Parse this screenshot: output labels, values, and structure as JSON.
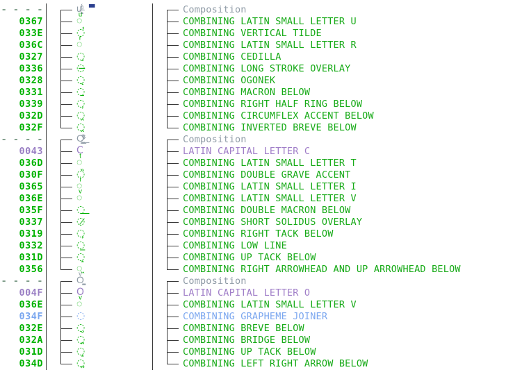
{
  "app": {
    "title": "Unicode Composition Tree",
    "composition_label": "Composition",
    "group_separator": "- - - -"
  },
  "colors": {
    "combining_green": "#00b200",
    "base_letter_purple": "#9a7fc4",
    "format_char_blue": "#7ba7ef",
    "heading_gray": "#8f9ba6",
    "separator_dash": "#7f9d8a",
    "tree_line": "#3a3a3a",
    "background": "#ffffff"
  },
  "groups": [
    {
      "header": {
        "code": "- - - -",
        "glyph": "u̶̧̨̱̹̭̯ͧ̾ͬ",
        "name": "Composition",
        "color": "gray",
        "code_color": "dash"
      },
      "rows": [
        {
          "code": "0367",
          "glyph": "◌ͧ",
          "name": "COMBINING LATIN SMALL LETTER U",
          "color": "green"
        },
        {
          "code": "033E",
          "glyph": "◌̾",
          "name": "COMBINING VERTICAL TILDE",
          "color": "green"
        },
        {
          "code": "036C",
          "glyph": "◌ͬ",
          "name": "COMBINING LATIN SMALL LETTER R",
          "color": "green"
        },
        {
          "code": "0327",
          "glyph": "◌̧",
          "name": "COMBINING CEDILLA",
          "color": "green"
        },
        {
          "code": "0336",
          "glyph": "◌̶",
          "name": "COMBINING LONG STROKE OVERLAY",
          "color": "green"
        },
        {
          "code": "0328",
          "glyph": "◌̨",
          "name": "COMBINING OGONEK",
          "color": "green"
        },
        {
          "code": "0331",
          "glyph": "◌̱",
          "name": "COMBINING MACRON BELOW",
          "color": "green"
        },
        {
          "code": "0339",
          "glyph": "◌̹",
          "name": "COMBINING RIGHT HALF RING BELOW",
          "color": "green"
        },
        {
          "code": "032D",
          "glyph": "◌̭",
          "name": "COMBINING CIRCUMFLEX ACCENT BELOW",
          "color": "green"
        },
        {
          "code": "032F",
          "glyph": "◌̯",
          "name": "COMBINING INVERTED BREVE BELOW",
          "color": "green"
        }
      ]
    },
    {
      "header": {
        "code": "- - - -",
        "glyph": "C̷̙̲̝͖ͭ̏ͥͮ͟",
        "name": "Composition",
        "color": "gray",
        "code_color": "dash"
      },
      "rows": [
        {
          "code": "0043",
          "glyph": "C",
          "name": "LATIN CAPITAL LETTER C",
          "color": "purple"
        },
        {
          "code": "036D",
          "glyph": "◌ͭ",
          "name": "COMBINING LATIN SMALL LETTER T",
          "color": "green"
        },
        {
          "code": "030F",
          "glyph": "◌̏",
          "name": "COMBINING DOUBLE GRAVE ACCENT",
          "color": "green"
        },
        {
          "code": "0365",
          "glyph": "◌ͥ",
          "name": "COMBINING LATIN SMALL LETTER I",
          "color": "green"
        },
        {
          "code": "036E",
          "glyph": "◌ͮ",
          "name": "COMBINING LATIN SMALL LETTER V",
          "color": "green"
        },
        {
          "code": "035F",
          "glyph": "◌͟",
          "name": "COMBINING DOUBLE MACRON BELOW",
          "color": "green"
        },
        {
          "code": "0337",
          "glyph": "◌̷",
          "name": "COMBINING SHORT SOLIDUS OVERLAY",
          "color": "green"
        },
        {
          "code": "0319",
          "glyph": "◌̙",
          "name": "COMBINING RIGHT TACK BELOW",
          "color": "green"
        },
        {
          "code": "0332",
          "glyph": "◌̲",
          "name": "COMBINING LOW LINE",
          "color": "green"
        },
        {
          "code": "031D",
          "glyph": "◌̝",
          "name": "COMBINING UP TACK BELOW",
          "color": "green"
        },
        {
          "code": "0356",
          "glyph": "◌͖",
          "name": "COMBINING RIGHT ARROWHEAD AND UP ARROWHEAD BELOW",
          "color": "green"
        }
      ]
    },
    {
      "header": {
        "code": "- - - -",
        "glyph": "Oͮ͏̮̪̝͍",
        "name": "Composition",
        "color": "gray",
        "code_color": "dash"
      },
      "rows": [
        {
          "code": "004F",
          "glyph": "O",
          "name": "LATIN CAPITAL LETTER O",
          "color": "purple"
        },
        {
          "code": "036E",
          "glyph": "◌ͮ",
          "name": "COMBINING LATIN SMALL LETTER V",
          "color": "green"
        },
        {
          "code": "034F",
          "glyph": "◌͏",
          "name": "COMBINING GRAPHEME JOINER",
          "color": "blue"
        },
        {
          "code": "032E",
          "glyph": "◌̮",
          "name": "COMBINING BREVE BELOW",
          "color": "green"
        },
        {
          "code": "032A",
          "glyph": "◌̪",
          "name": "COMBINING BRIDGE BELOW",
          "color": "green"
        },
        {
          "code": "031D",
          "glyph": "◌̝",
          "name": "COMBINING UP TACK BELOW",
          "color": "green"
        },
        {
          "code": "034D",
          "glyph": "◌͍",
          "name": "COMBINING LEFT RIGHT ARROW BELOW",
          "color": "green"
        }
      ]
    }
  ]
}
